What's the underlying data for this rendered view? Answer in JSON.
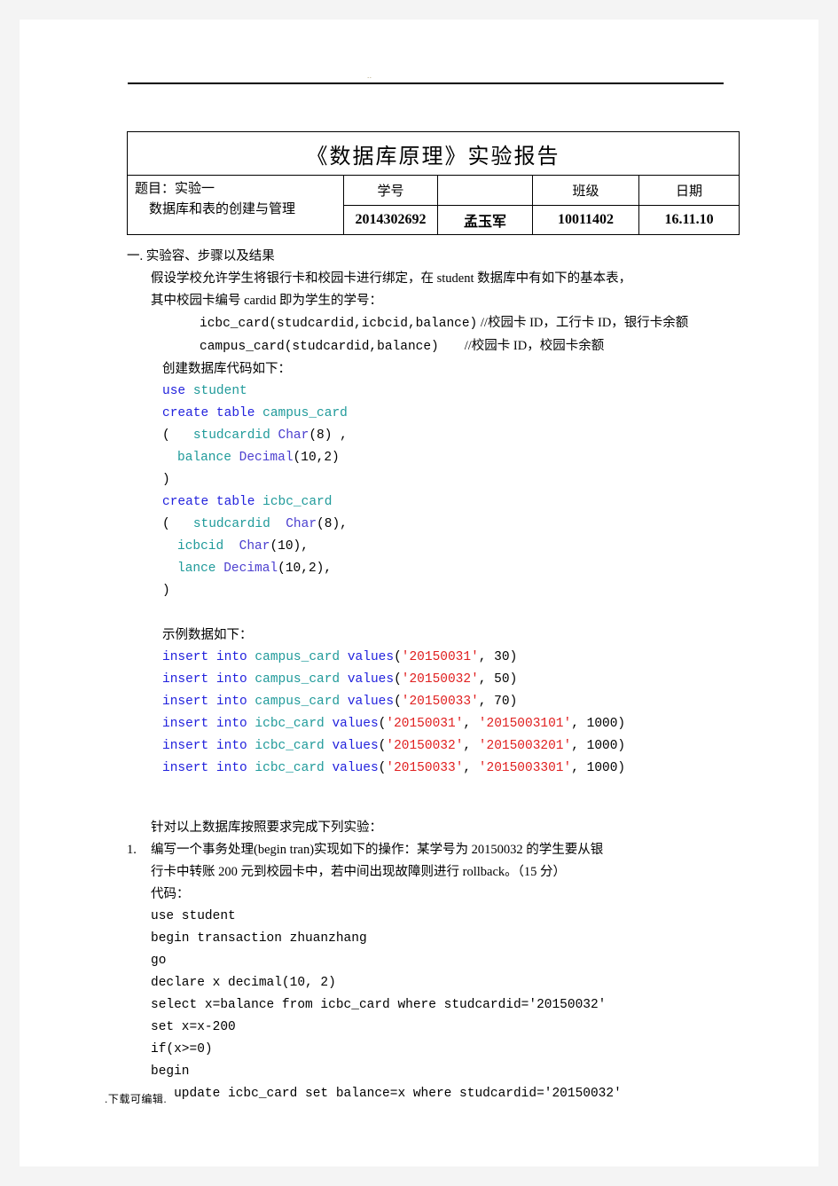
{
  "page": {
    "header_marks": "..",
    "footer_text": ".下载可编辑."
  },
  "title_table": {
    "doc_title": "《数据库原理》实验报告",
    "subject_label_line1": "题目：实验一",
    "subject_label_line2": "数据库和表的创建与管理",
    "headers": {
      "student_id": "学号",
      "name": "",
      "class": "班级",
      "date": "日期"
    },
    "values": {
      "student_id": "2014302692",
      "name": "孟玉军",
      "class": "10011402",
      "date": "16.11.10"
    }
  },
  "section": {
    "heading": "一. 实验容、步骤以及结果",
    "intro_line1": "假设学校允许学生将银行卡和校园卡进行绑定，在 student 数据库中有如下的基本表，",
    "intro_line2": "其中校园卡编号 cardid 即为学生的学号：",
    "schema": {
      "icbc_signature": "icbc_card(studcardid,icbcid,balance)",
      "icbc_comment": "//校园卡 ID，工行卡 ID，银行卡余额",
      "campus_signature": "campus_card(studcardid,balance)",
      "campus_comment": "//校园卡 ID，校园卡余额"
    },
    "create_label": "创建数据库代码如下：",
    "sample_label": "示例数据如下：",
    "tasks_intro": "针对以上数据库按照要求完成下列实验："
  },
  "create_code": {
    "use_kw": "use",
    "use_db": "student",
    "create_kw1": "create table",
    "create_tbl1": "campus_card",
    "open_paren1": "(",
    "c1_col1_name": "studcardid",
    "c1_col1_type": "Char",
    "c1_col1_args": "(8) ,",
    "c1_col2_name": "balance",
    "c1_col2_type": "Decimal",
    "c1_col2_args": "(10,2)",
    "close_paren1": ")",
    "create_kw2": "create table",
    "create_tbl2": "icbc_card",
    "open_paren2": "(",
    "c2_col1_name": "studcardid",
    "c2_col1_type": "Char",
    "c2_col1_args": "(8),",
    "c2_col2_name": "icbcid",
    "c2_col2_type": "Char",
    "c2_col2_args": "(10),",
    "c2_col3_name": "lance",
    "c2_col3_type": "Decimal",
    "c2_col3_args": "(10,2),",
    "close_paren2": ")"
  },
  "insert_code": {
    "kw": "insert into",
    "values_kw": "values",
    "campus_table": "campus_card",
    "icbc_table": "icbc_card",
    "campus_rows": [
      {
        "id": "'20150031'",
        "rest": ", 30)"
      },
      {
        "id": "'20150032'",
        "rest": ", 50)"
      },
      {
        "id": "'20150033'",
        "rest": ", 70)"
      }
    ],
    "icbc_rows": [
      {
        "id": "'20150031'",
        "card": "'2015003101'",
        "rest": ", 1000)"
      },
      {
        "id": "'20150032'",
        "card": "'2015003201'",
        "rest": ", 1000)"
      },
      {
        "id": "'20150033'",
        "card": "'2015003301'",
        "rest": ", 1000)"
      }
    ]
  },
  "task1": {
    "number": "1.",
    "line1": "编写一个事务处理(begin tran)实现如下的操作：某学号为 20150032 的学生要从银",
    "line2": "行卡中转账 200 元到校园卡中，若中间出现故障则进行 rollback。（15 分）",
    "code_label": "代码：",
    "code_lines": [
      "use student",
      "begin transaction zhuanzhang",
      "go",
      "declare x decimal(10, 2)",
      "select x=balance from icbc_card where studcardid='20150032'",
      "set x=x-200",
      "if(x>=0)",
      "begin",
      "   update icbc_card set balance=x where studcardid='20150032'"
    ]
  }
}
